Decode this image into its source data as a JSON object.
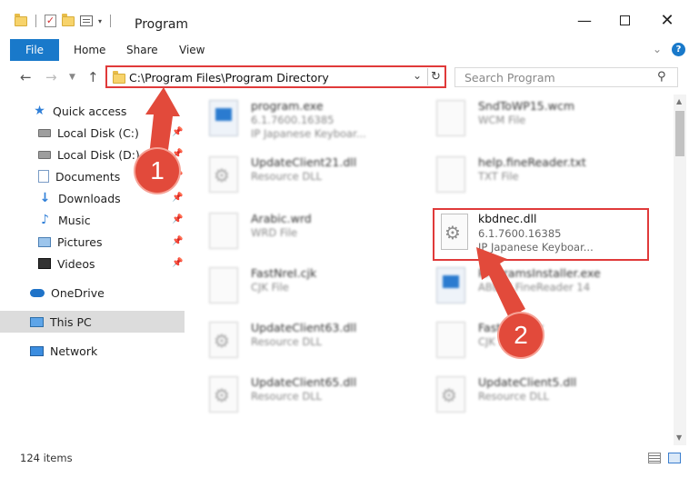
{
  "window": {
    "title": "Program",
    "minimize": "—",
    "close": "✕"
  },
  "ribbon": {
    "file": "File",
    "home": "Home",
    "share": "Share",
    "view": "View",
    "help": "?"
  },
  "address": {
    "path": "C:\\Program Files\\Program Directory",
    "dropdown": "⌄",
    "refresh": "↻"
  },
  "search": {
    "placeholder": "Search Program",
    "icon": "search-icon"
  },
  "nav": {
    "quick_access": "Quick access",
    "local_disk_c": "Local Disk (C:)",
    "local_disk_d": "Local Disk (D:)",
    "documents": "Documents",
    "downloads": "Downloads",
    "music": "Music",
    "pictures": "Pictures",
    "videos": "Videos",
    "onedrive": "OneDrive",
    "this_pc": "This PC",
    "network": "Network"
  },
  "files": [
    {
      "name": "program.exe",
      "line2": "6.1.7600.16385",
      "line3": "IP Japanese Keyboar...",
      "icon": "exe"
    },
    {
      "name": "SndToWP15.wcm",
      "line2": "WCM File",
      "line3": "",
      "icon": "doc"
    },
    {
      "name": "UpdateClient21.dll",
      "line2": "Resource DLL",
      "line3": "",
      "icon": "dll"
    },
    {
      "name": "help.fineReader.txt",
      "line2": "TXT File",
      "line3": "",
      "icon": "doc"
    },
    {
      "name": "Arabic.wrd",
      "line2": "WRD File",
      "line3": "",
      "icon": "doc"
    },
    {
      "name": "FastNreI.cjk",
      "line2": "CJK File",
      "line3": "",
      "icon": "doc"
    },
    {
      "name": "ProgramsInstaller.exe",
      "line2": "ABBYY FineReader 14",
      "line3": "",
      "icon": "exe"
    },
    {
      "name": "UpdateClient63.dll",
      "line2": "Resource DLL",
      "line3": "",
      "icon": "dll"
    },
    {
      "name": "FastNreI.cjk",
      "line2": "CJK File",
      "line3": "",
      "icon": "doc"
    },
    {
      "name": "UpdateClient65.dll",
      "line2": "Resource DLL",
      "line3": "",
      "icon": "dll"
    },
    {
      "name": "UpdateClient5.dll",
      "line2": "Resource DLL",
      "line3": "",
      "icon": "dll"
    }
  ],
  "highlighted_file": {
    "name": "kbdnec.dll",
    "line2": "6.1.7600.16385",
    "line3": "IP Japanese Keyboar..."
  },
  "status": {
    "count": "124 items"
  },
  "callouts": {
    "one": "1",
    "two": "2",
    "color": "#e24a3b"
  },
  "colors": {
    "accent": "#1979ca",
    "highlight_border": "#e03a3a",
    "selected_nav": "#dcdcdc"
  }
}
